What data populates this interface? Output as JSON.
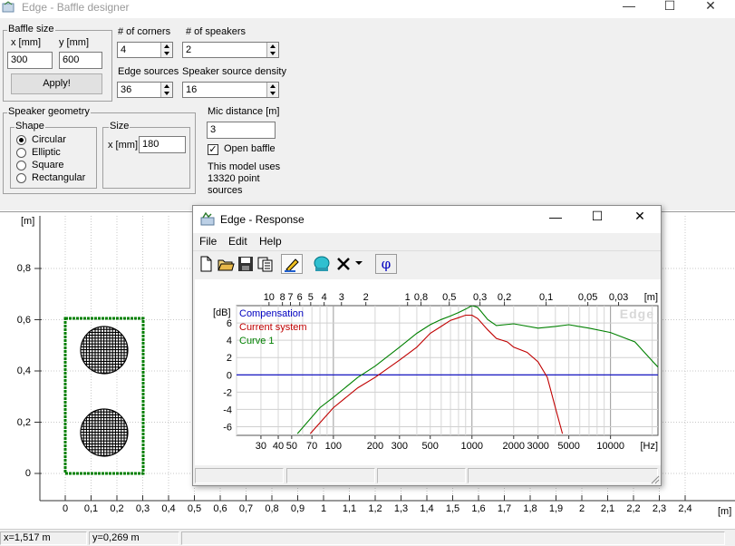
{
  "window": {
    "title": "Edge - Baffle designer",
    "controls": [
      "—",
      "☐",
      "✕"
    ]
  },
  "baffle_size": {
    "title": "Baffle size",
    "x_label": "x [mm]",
    "y_label": "y [mm]",
    "x_value": "300",
    "y_value": "600",
    "apply_label": "Apply!"
  },
  "corners": {
    "label": "# of corners",
    "value": "4"
  },
  "speakers": {
    "label": "# of speakers",
    "value": "2"
  },
  "edge_sources": {
    "label": "Edge sources",
    "value": "36"
  },
  "speaker_density": {
    "label": "Speaker source density",
    "value": "16"
  },
  "speaker_geometry": {
    "title": "Speaker geometry",
    "shape_title": "Shape",
    "shapes": [
      "Circular",
      "Elliptic",
      "Square",
      "Rectangular"
    ],
    "selected_shape": "Circular",
    "size_title": "Size",
    "size_label": "x [mm]",
    "size_value": "180"
  },
  "mic": {
    "label": "Mic distance [m]",
    "value": "3",
    "open_baffle_label": "Open baffle",
    "open_baffle_checked": true,
    "info": [
      "This model uses",
      "13320 point",
      "sources"
    ]
  },
  "baffle_plot": {
    "y_unit": "[m]",
    "x_unit": "[m]",
    "y_ticks": [
      "0,8",
      "0,6",
      "0,4",
      "0,2",
      "0"
    ],
    "x_ticks": [
      "0",
      "0,1",
      "0,2",
      "0,3",
      "0,4",
      "0,5",
      "0,6",
      "0,7",
      "0,8",
      "0,9",
      "1",
      "1,1",
      "1,2",
      "1,3",
      "1,4",
      "1,5",
      "1,6",
      "1,7",
      "1,8",
      "1,9",
      "2",
      "2,1",
      "2,2",
      "2,3",
      "2,4"
    ],
    "baffle_color": "#008000"
  },
  "status": {
    "x": "x=1,517 m",
    "y": "y=0,269 m"
  },
  "response": {
    "title": "Edge - Response",
    "controls": [
      "—",
      "☐",
      "✕"
    ],
    "menu": [
      "File",
      "Edit",
      "Help"
    ],
    "toolbar_icons": [
      "new-file-icon",
      "open-folder-icon",
      "save-icon",
      "copy-icon",
      "pencil-icon",
      "speaker-icon",
      "delete-icon",
      "dropdown-arrow-icon",
      "phase-icon"
    ],
    "phase_symbol": "φ"
  },
  "chart_data": {
    "type": "line",
    "title": "",
    "xlabel": "[Hz]",
    "ylabel": "[dB]",
    "x_scale": "log",
    "xlim": [
      20,
      22000
    ],
    "ylim": [
      -7,
      8
    ],
    "y_ticks": [
      6,
      4,
      2,
      0,
      -2,
      -4,
      -6
    ],
    "x_ticks": [
      30,
      40,
      50,
      70,
      100,
      200,
      300,
      500,
      1000,
      2000,
      3000,
      5000,
      10000
    ],
    "x_tick_labels": [
      "30",
      "40",
      "50",
      "70",
      "100",
      "200",
      "300",
      "500",
      "1000",
      "2000",
      "3000",
      "5000",
      "10000"
    ],
    "top_axis_unit": "[m]",
    "top_axis_labels": [
      "10",
      "8",
      "7",
      "6",
      "5",
      "4",
      "3",
      "2",
      "1",
      "0,8",
      "0,5",
      "0,3",
      "0,2",
      "0,1",
      "0,05",
      "0,03"
    ],
    "top_axis_values_m": [
      10,
      8,
      7,
      6,
      5,
      4,
      3,
      2,
      1,
      0.8,
      0.5,
      0.3,
      0.2,
      0.1,
      0.05,
      0.03
    ],
    "watermark": "Edge",
    "grid": true,
    "legend_position": "top-left",
    "series": [
      {
        "name": "Compensation",
        "color": "#0000c0",
        "points": [
          [
            20,
            0
          ],
          [
            22000,
            0
          ]
        ]
      },
      {
        "name": "Current system",
        "color": "#c00000",
        "points": [
          [
            68,
            -6.8
          ],
          [
            100,
            -3.8
          ],
          [
            150,
            -1.5
          ],
          [
            200,
            -0.3
          ],
          [
            300,
            1.7
          ],
          [
            400,
            3.2
          ],
          [
            500,
            4.8
          ],
          [
            600,
            5.6
          ],
          [
            700,
            6.3
          ],
          [
            800,
            6.6
          ],
          [
            900,
            6.9
          ],
          [
            1000,
            6.9
          ],
          [
            1100,
            6.5
          ],
          [
            1300,
            5.2
          ],
          [
            1500,
            4.2
          ],
          [
            1800,
            3.8
          ],
          [
            2000,
            3.2
          ],
          [
            2500,
            2.6
          ],
          [
            3000,
            1.5
          ],
          [
            3500,
            -0.3
          ],
          [
            4000,
            -3.8
          ],
          [
            4500,
            -6.8
          ]
        ]
      },
      {
        "name": "Curve 1",
        "color": "#008000",
        "points": [
          [
            55,
            -6.8
          ],
          [
            80,
            -3.8
          ],
          [
            100,
            -2.6
          ],
          [
            150,
            -0.3
          ],
          [
            200,
            1.0
          ],
          [
            300,
            3.2
          ],
          [
            400,
            4.8
          ],
          [
            500,
            5.8
          ],
          [
            600,
            6.4
          ],
          [
            700,
            6.8
          ],
          [
            800,
            7.2
          ],
          [
            900,
            7.6
          ],
          [
            1000,
            8.0
          ],
          [
            1100,
            7.8
          ],
          [
            1300,
            6.4
          ],
          [
            1500,
            5.7
          ],
          [
            2000,
            5.9
          ],
          [
            3000,
            5.4
          ],
          [
            4000,
            5.6
          ],
          [
            5000,
            5.8
          ],
          [
            7000,
            5.4
          ],
          [
            10000,
            4.9
          ],
          [
            15000,
            3.8
          ],
          [
            20000,
            1.6
          ],
          [
            22000,
            0.9
          ]
        ]
      }
    ]
  }
}
